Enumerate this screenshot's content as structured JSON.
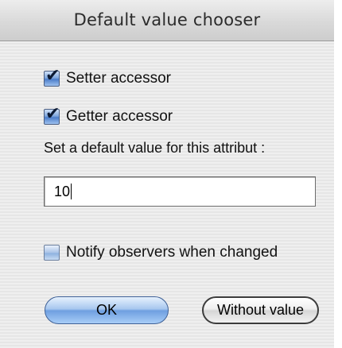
{
  "window": {
    "title": "Default value chooser"
  },
  "options": {
    "setter": {
      "label": "Setter accessor",
      "checked": true
    },
    "getter": {
      "label": "Getter accessor",
      "checked": true
    },
    "notify": {
      "label": "Notify observers when changed",
      "checked": false
    }
  },
  "default_value": {
    "prompt": "Set a default value for this attribut :",
    "value": "10"
  },
  "buttons": {
    "ok_label": "OK",
    "without_value_label": "Without value"
  }
}
